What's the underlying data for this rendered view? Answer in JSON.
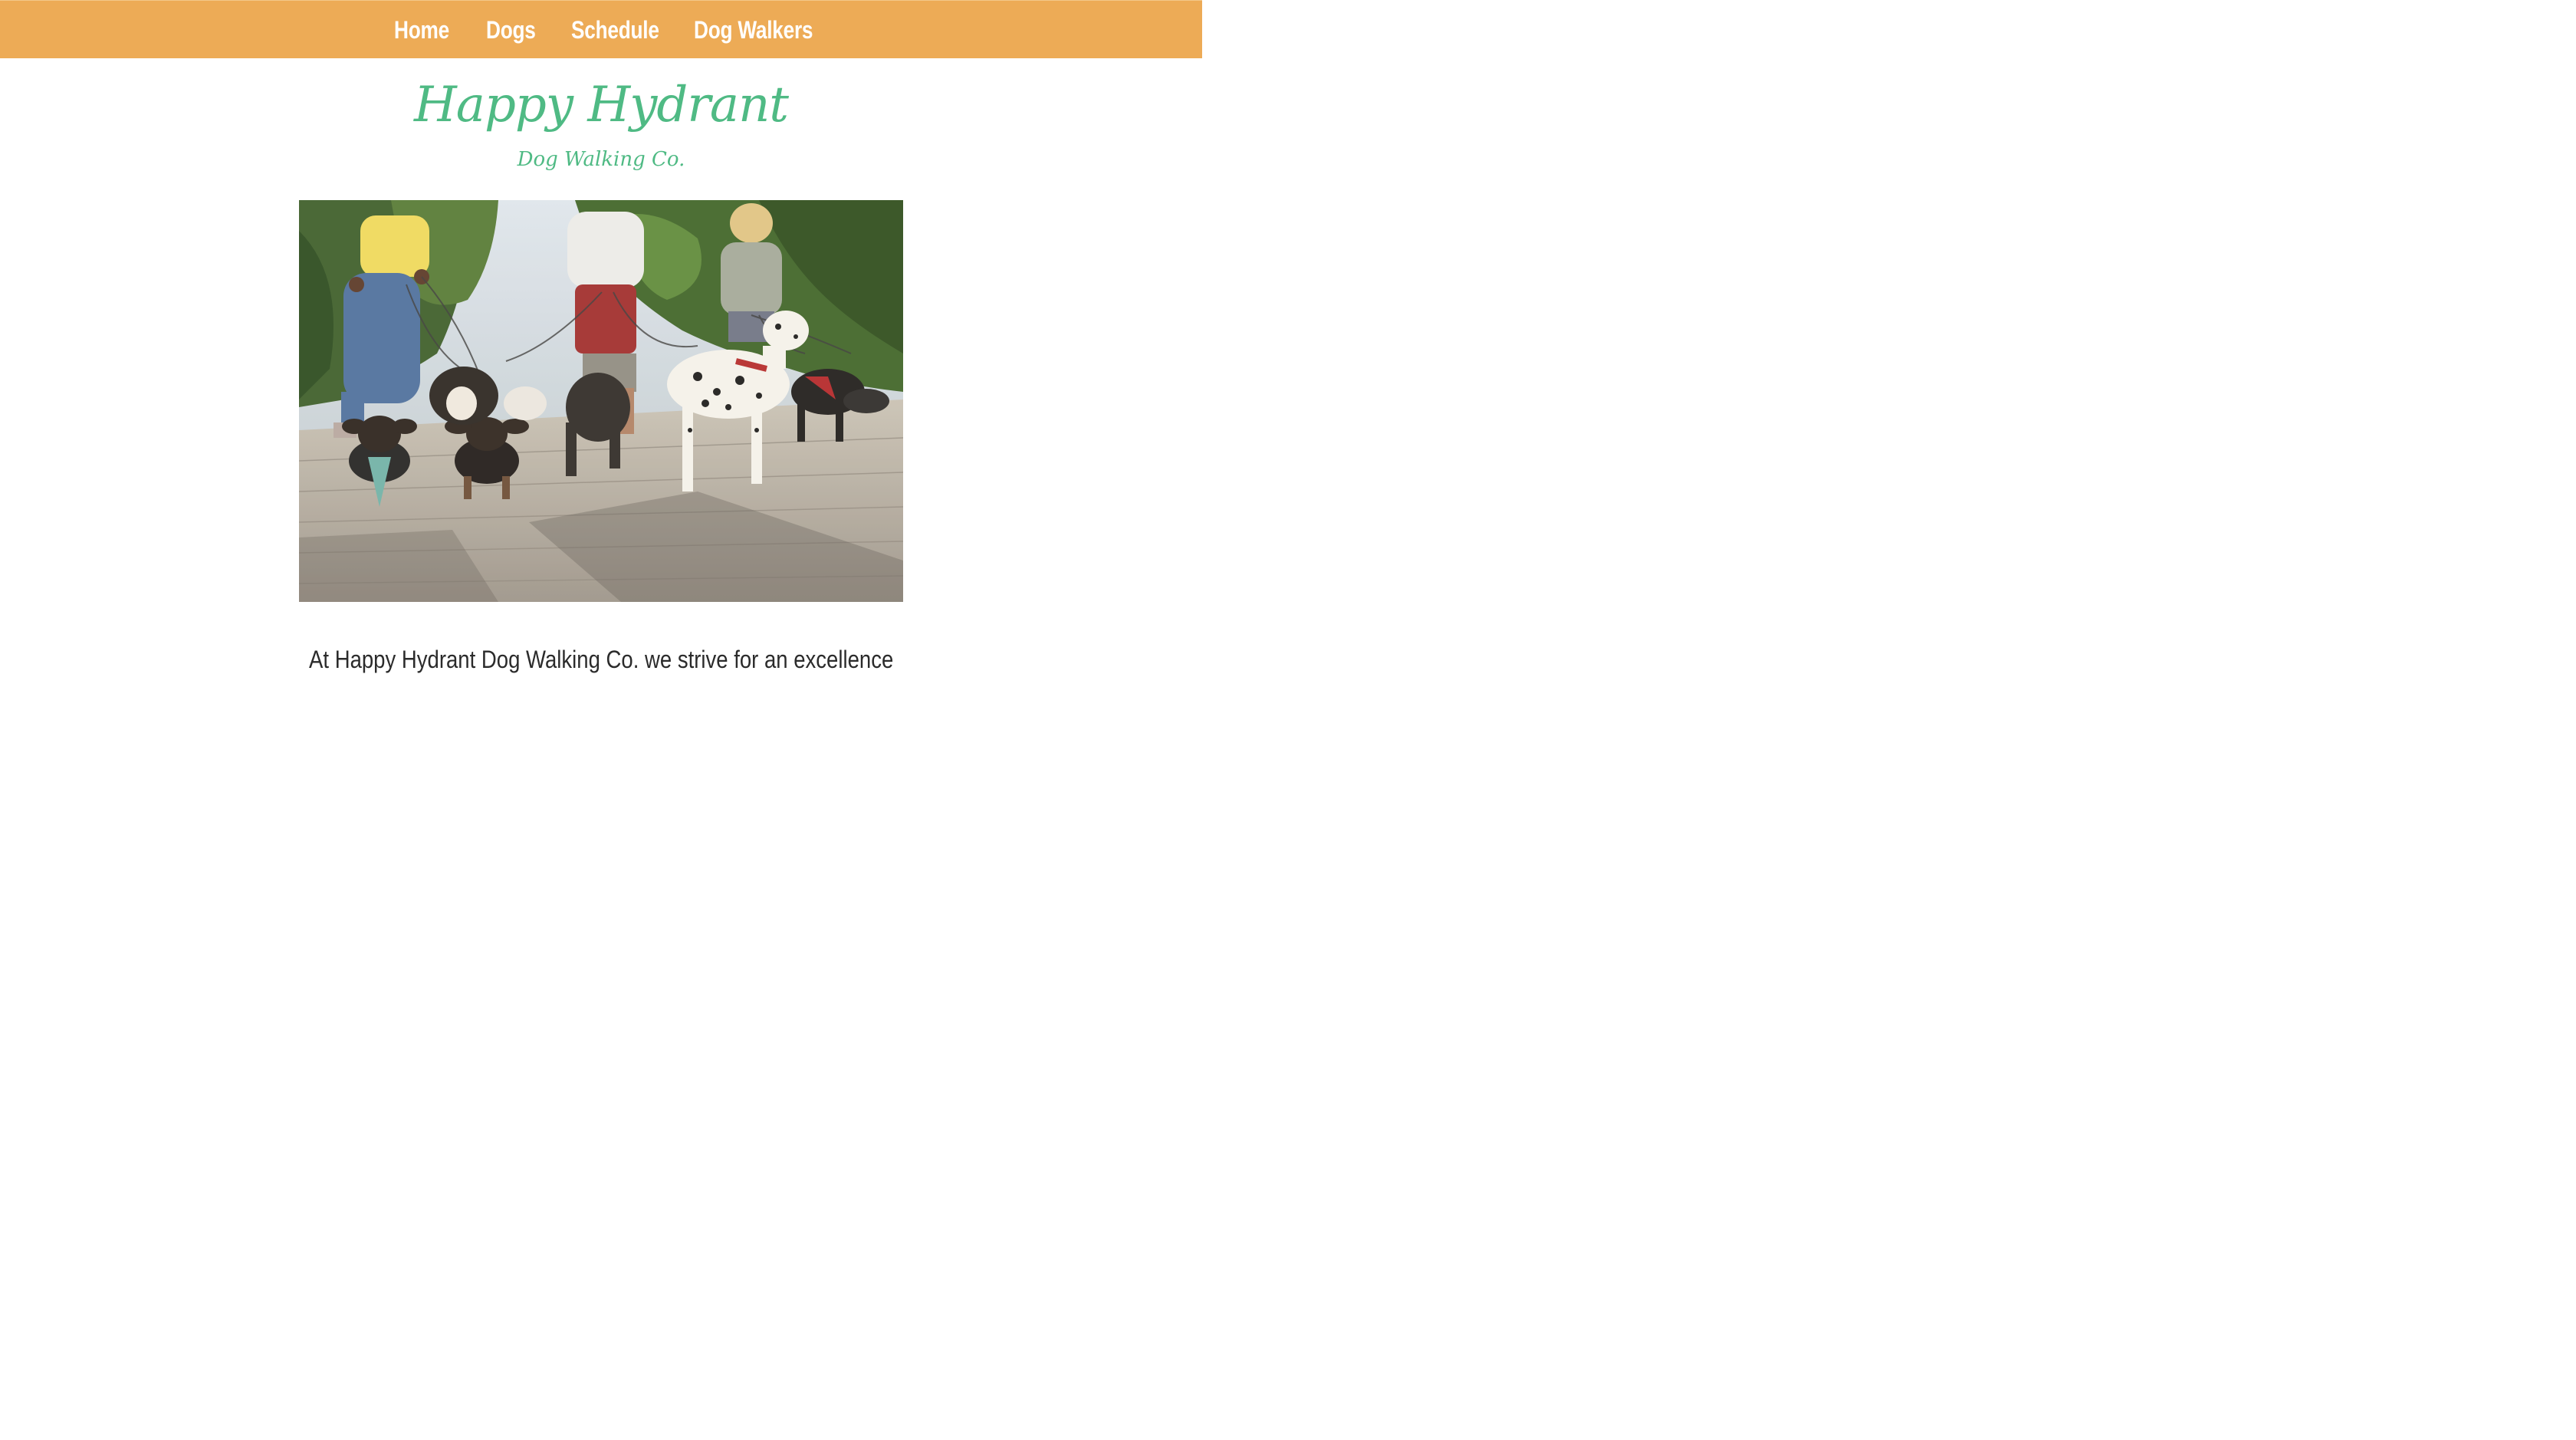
{
  "nav": {
    "items": [
      {
        "label": "Home"
      },
      {
        "label": "Dogs"
      },
      {
        "label": "Schedule"
      },
      {
        "label": "Dog Walkers"
      }
    ]
  },
  "brand": {
    "title": "Happy Hydrant",
    "subtitle": "Dog Walking Co."
  },
  "hero": {
    "alt": "Dog walkers walking a group of dogs on a sunny tree-lined path"
  },
  "intro": {
    "text": "At Happy Hydrant Dog Walking Co. we strive for an excellence"
  },
  "colors": {
    "nav_background": "#edab56",
    "nav_text": "#ffffff",
    "brand_green": "#4fba84",
    "body_text": "#2b2b2b"
  }
}
